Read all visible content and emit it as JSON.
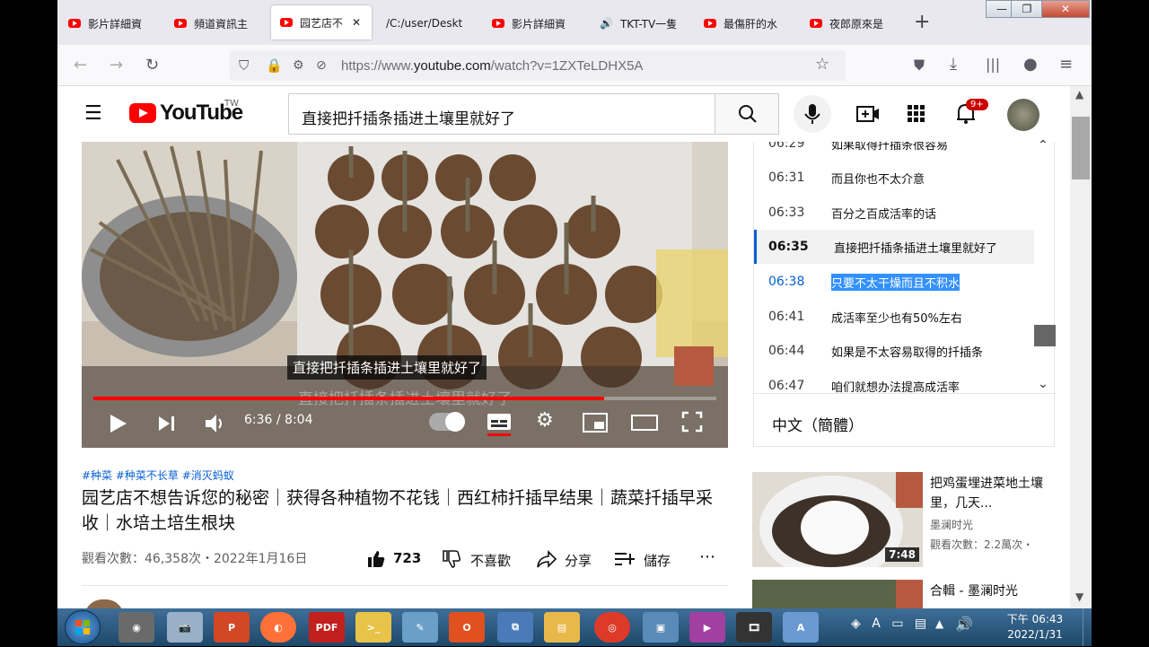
{
  "tabs": [
    {
      "label": "影片詳細資"
    },
    {
      "label": "頻道資訊主"
    },
    {
      "label": "园艺店不",
      "close": "✕"
    },
    {
      "label": "/C:/user/Deskt"
    },
    {
      "label": "影片詳細資"
    },
    {
      "label": "TKT-TV一隻"
    },
    {
      "label": "最傷肝的水"
    },
    {
      "label": "夜郎原來是"
    }
  ],
  "new_tab": "+",
  "url": {
    "prefix": "https://www.",
    "domain": "youtube.com",
    "path": "/watch?v=1ZXTeLDHX5A"
  },
  "yt": {
    "logo_text": "YouTube",
    "region": "TW",
    "search_value": "直接把扦插条插进土壤里就好了",
    "notif_count": "9+"
  },
  "player": {
    "caption": "直接把扦插条插进土壤里就好了",
    "time": "6:36 / 8:04",
    "progress": 0.82,
    "burned_caption": "直接把扦插条插进土壤里就好了"
  },
  "transcript": {
    "items": [
      {
        "ts": "06:29",
        "text": "如果取得扦插条很容易"
      },
      {
        "ts": "06:31",
        "text": "而且你也不太介意"
      },
      {
        "ts": "06:33",
        "text": "百分之百成活率的话"
      },
      {
        "ts": "06:35",
        "text": "直接把扦插条插进土壤里就好了"
      },
      {
        "ts": "06:38",
        "text": "只要不太干燥而且不积水"
      },
      {
        "ts": "06:41",
        "text": "成活率至少也有50%左右"
      },
      {
        "ts": "06:44",
        "text": "如果是不太容易取得的扦插条"
      },
      {
        "ts": "06:47",
        "text": "咱们就想办法提高成活率"
      }
    ],
    "language": "中文（簡體）"
  },
  "video_info": {
    "tags": "#种菜 #种菜不长草 #消灭蚂蚁",
    "title": "园艺店不想告诉您的秘密｜获得各种植物不花钱｜西红柿扦插早结果｜蔬菜扦插早采收｜水培土培生根块",
    "meta": "觀看次數：46,358次・2022年1月16日",
    "likes": "723",
    "dislike_label": "不喜歡",
    "share_label": "分享",
    "save_label": "儲存",
    "more": "⋯"
  },
  "suggestions": [
    {
      "title": "把鸡蛋埋进菜地土壤里，几天...",
      "channel": "墨澜时光",
      "views": "觀看次數：2.2萬次・",
      "duration": "7:48"
    },
    {
      "title": "合輯 - 墨澜时光"
    }
  ],
  "taskbar": {
    "time": "下午 06:43",
    "date": "2022/1/31"
  },
  "window_controls": [
    "—",
    "❐",
    "✕"
  ]
}
